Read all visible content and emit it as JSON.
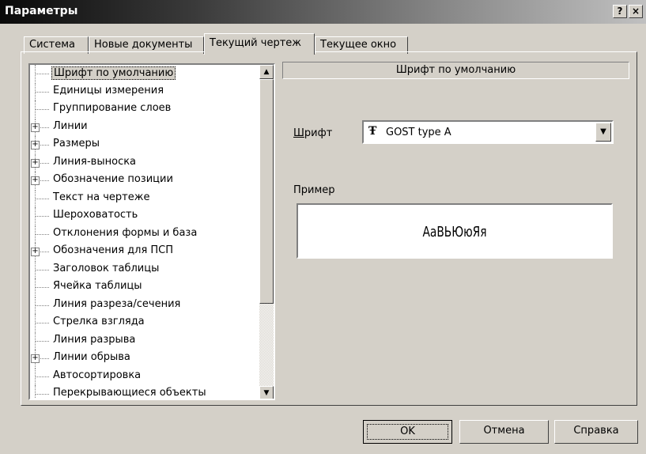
{
  "window": {
    "title": "Параметры",
    "help_glyph": "?",
    "close_glyph": "×"
  },
  "tabs": [
    {
      "label": "Система",
      "active": false
    },
    {
      "label": "Новые документы",
      "active": false
    },
    {
      "label": "Текущий чертеж",
      "active": true
    },
    {
      "label": "Текущее окно",
      "active": false
    }
  ],
  "tree": {
    "items": [
      {
        "label": "Шрифт по умолчанию",
        "expandable": false,
        "selected": true
      },
      {
        "label": "Единицы измерения",
        "expandable": false
      },
      {
        "label": "Группирование слоев",
        "expandable": false
      },
      {
        "label": "Линии",
        "expandable": true
      },
      {
        "label": "Размеры",
        "expandable": true
      },
      {
        "label": "Линия-выноска",
        "expandable": true
      },
      {
        "label": "Обозначение позиции",
        "expandable": true
      },
      {
        "label": "Текст на чертеже",
        "expandable": false
      },
      {
        "label": "Шероховатость",
        "expandable": false
      },
      {
        "label": "Отклонения формы и база",
        "expandable": false
      },
      {
        "label": "Обозначения для ПСП",
        "expandable": true
      },
      {
        "label": "Заголовок таблицы",
        "expandable": false
      },
      {
        "label": "Ячейка таблицы",
        "expandable": false
      },
      {
        "label": "Линия разреза/сечения",
        "expandable": false
      },
      {
        "label": "Стрелка взгляда",
        "expandable": false
      },
      {
        "label": "Линия разрыва",
        "expandable": false
      },
      {
        "label": "Линии обрыва",
        "expandable": true
      },
      {
        "label": "Автосортировка",
        "expandable": false
      },
      {
        "label": "Перекрывающиеся объекты",
        "expandable": false
      }
    ],
    "expander_glyph": "+",
    "scroll_up_glyph": "▲",
    "scroll_down_glyph": "▼"
  },
  "panel": {
    "header": "Шрифт по умолчанию",
    "font_label_accel": "Ш",
    "font_label_rest": "рифт",
    "font_icon": "Ŧ",
    "font_value": "GOST type A",
    "combo_drop_glyph": "▼",
    "sample_label": "Пример",
    "sample_text": "АаВЬЮюЯя"
  },
  "buttons": {
    "ok": "OK",
    "cancel": "Отмена",
    "help": "Справка"
  }
}
